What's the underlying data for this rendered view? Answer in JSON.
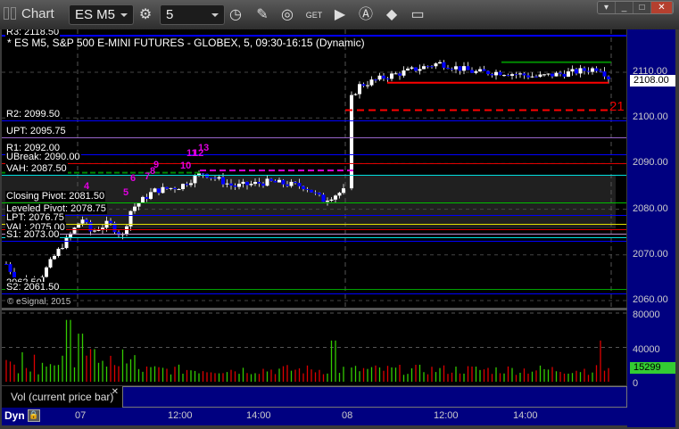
{
  "window": {
    "title": "Chart",
    "symbol": "ES M5",
    "interval": "5"
  },
  "toolbar_icons": [
    "gear-icon",
    "clock-icon",
    "pencil-icon",
    "study-icon",
    "get-data-icon",
    "play-icon",
    "alert-icon",
    "link-icon",
    "comment-icon"
  ],
  "chart": {
    "header": "* ES M5, S&P 500 E-MINI FUTURES - GLOBEX, 5, 09:30-16:15 (Dynamic)",
    "copyright": "© eSignal, 2015",
    "levels": [
      {
        "label": "R3: 2118.50",
        "price": 2118.5,
        "color": "#0000ff"
      },
      {
        "label": "R2: 2099.50",
        "price": 2099.5,
        "color": "#0000ff"
      },
      {
        "label": "UPT: 2095.75",
        "price": 2095.75,
        "color": "#9966cc"
      },
      {
        "label": "R1: 2092.00",
        "price": 2092.0,
        "color": "#0000ff"
      },
      {
        "label": "UBreak: 2090.00",
        "price": 2090.0,
        "color": "#e00000"
      },
      {
        "label": "VAH: 2087.50",
        "price": 2087.5,
        "color": "#00e0e0"
      },
      {
        "label": "Closing Pivot: 2081.50",
        "price": 2081.5,
        "color": "#00c000"
      },
      {
        "label": "Leveled Pivot: 2078.75",
        "price": 2078.75,
        "color": "#0000ff"
      },
      {
        "label": "LPT: 2076.75",
        "price": 2076.75,
        "color": "#e0e000"
      },
      {
        "label": "",
        "price": 2075.6,
        "color": "#e00000"
      },
      {
        "label": "VAL: 2075.00",
        "price": 2074.6,
        "color": "#bb88cc"
      },
      {
        "label": "",
        "price": 2073.9,
        "color": "#00e0e0"
      },
      {
        "label": "S1: 2073.00",
        "price": 2073.0,
        "color": "#0000ff"
      },
      {
        "label": "2062.50",
        "price": 2062.5,
        "color": "#00a000"
      },
      {
        "label": "S2: 2061.50",
        "price": 2061.5,
        "color": "#0000ff"
      }
    ],
    "count_labels": [
      "4",
      "5",
      "6",
      "7",
      "8",
      "9",
      "10",
      "11",
      "12",
      "13"
    ],
    "target_label": "21",
    "price_ticks": [
      "2110.00",
      "2100.00",
      "2090.00",
      "2080.00",
      "2070.00",
      "2060.00"
    ],
    "last_price": "2108.00",
    "volume_ticks": [
      "80000",
      "40000",
      "0"
    ],
    "last_volume": "15299",
    "volume_legend": "Vol (current price bar)",
    "time_ticks": [
      "07",
      "12:00",
      "14:00",
      "08",
      "12:00",
      "14:00"
    ],
    "mode": "Dyn",
    "colors": {
      "up": "#ffffff",
      "down": "#0000ff",
      "vol_up": "#33cc00",
      "vol_down": "#dd0000",
      "axis_bg": "#000080"
    }
  }
}
